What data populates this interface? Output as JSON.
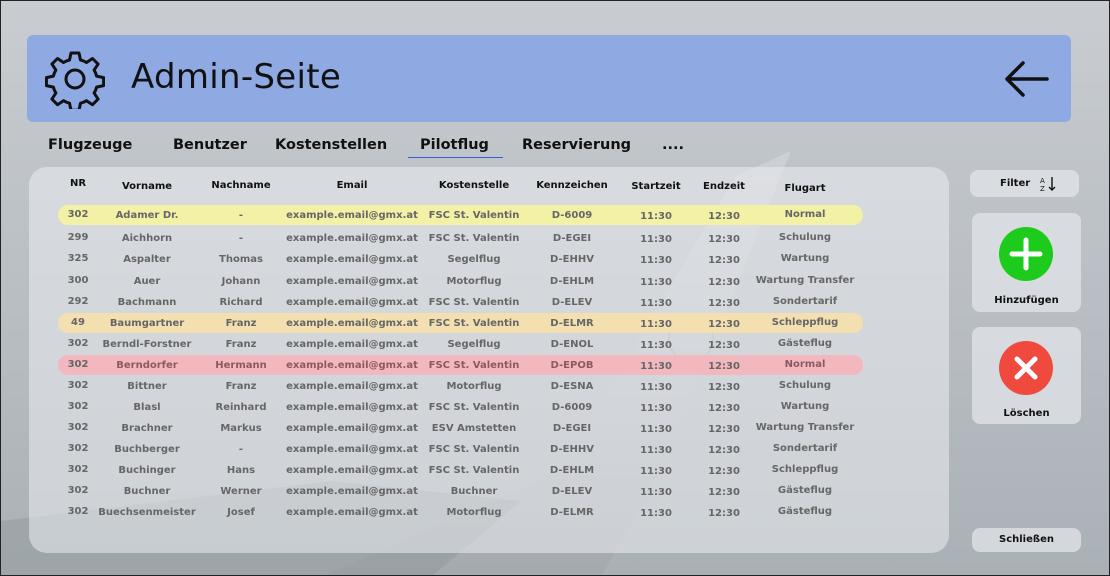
{
  "header": {
    "title": "Admin-Seite",
    "settings_icon": "gear-icon",
    "back_icon": "arrow-left-icon"
  },
  "tabs": [
    {
      "label": "Flugzeuge"
    },
    {
      "label": "Benutzer"
    },
    {
      "label": "Kostenstellen"
    },
    {
      "label": "Pilotflug",
      "active": true
    },
    {
      "label": "Reservierung"
    },
    {
      "label": "...."
    }
  ],
  "table": {
    "columns": [
      "NR",
      "Vorname",
      "Nachname",
      "Email",
      "Kostenstelle",
      "Kennzeichen",
      "Startzeit",
      "Endzeit",
      "Flugart"
    ],
    "rows": [
      {
        "nr": "302",
        "vorname": "Adamer Dr.",
        "nachname": "-",
        "email": "example.email@gmx.at",
        "kostenstelle": "FSC St. Valentin",
        "kennzeichen": "D-6009",
        "start": "11:30",
        "end": "12:30",
        "flugart": "Normal",
        "highlight": "#f3f1a6"
      },
      {
        "nr": "299",
        "vorname": "Aichhorn",
        "nachname": "-",
        "email": "example.email@gmx.at",
        "kostenstelle": "FSC St. Valentin",
        "kennzeichen": "D-EGEI",
        "start": "11:30",
        "end": "12:30",
        "flugart": "Schulung",
        "highlight": ""
      },
      {
        "nr": "325",
        "vorname": "Aspalter",
        "nachname": "Thomas",
        "email": "example.email@gmx.at",
        "kostenstelle": "Segelflug",
        "kennzeichen": "D-EHHV",
        "start": "11:30",
        "end": "12:30",
        "flugart": "Wartung",
        "highlight": ""
      },
      {
        "nr": "300",
        "vorname": "Auer",
        "nachname": "Johann",
        "email": "example.email@gmx.at",
        "kostenstelle": "Motorflug",
        "kennzeichen": "D-EHLM",
        "start": "11:30",
        "end": "12:30",
        "flugart": "Wartung Transfer",
        "highlight": ""
      },
      {
        "nr": "292",
        "vorname": "Bachmann",
        "nachname": "Richard",
        "email": "example.email@gmx.at",
        "kostenstelle": "FSC St. Valentin",
        "kennzeichen": "D-ELEV",
        "start": "11:30",
        "end": "12:30",
        "flugart": "Sondertarif",
        "highlight": ""
      },
      {
        "nr": "49",
        "vorname": "Baumgartner",
        "nachname": "Franz",
        "email": "example.email@gmx.at",
        "kostenstelle": "FSC St. Valentin",
        "kennzeichen": "D-ELMR",
        "start": "11:30",
        "end": "12:30",
        "flugart": "Schleppflug",
        "highlight": "#f4dfb0"
      },
      {
        "nr": "302",
        "vorname": "Berndl-Forstner",
        "nachname": "Franz",
        "email": "example.email@gmx.at",
        "kostenstelle": "Segelflug",
        "kennzeichen": "D-ENOL",
        "start": "11:30",
        "end": "12:30",
        "flugart": "Gästeflug",
        "highlight": ""
      },
      {
        "nr": "302",
        "vorname": "Berndorfer",
        "nachname": "Hermann",
        "email": "example.email@gmx.at",
        "kostenstelle": "FSC St. Valentin",
        "kennzeichen": "D-EPOB",
        "start": "11:30",
        "end": "12:30",
        "flugart": "Normal",
        "highlight": "#f2b8be"
      },
      {
        "nr": "302",
        "vorname": "Bittner",
        "nachname": "Franz",
        "email": "example.email@gmx.at",
        "kostenstelle": "Motorflug",
        "kennzeichen": "D-ESNA",
        "start": "11:30",
        "end": "12:30",
        "flugart": "Schulung",
        "highlight": ""
      },
      {
        "nr": "302",
        "vorname": "Blasl",
        "nachname": "Reinhard",
        "email": "example.email@gmx.at",
        "kostenstelle": "FSC St. Valentin",
        "kennzeichen": "D-6009",
        "start": "11:30",
        "end": "12:30",
        "flugart": "Wartung",
        "highlight": ""
      },
      {
        "nr": "302",
        "vorname": "Brachner",
        "nachname": "Markus",
        "email": "example.email@gmx.at",
        "kostenstelle": "ESV Amstetten",
        "kennzeichen": "D-EGEI",
        "start": "11:30",
        "end": "12:30",
        "flugart": "Wartung Transfer",
        "highlight": ""
      },
      {
        "nr": "302",
        "vorname": "Buchberger",
        "nachname": "-",
        "email": "example.email@gmx.at",
        "kostenstelle": "FSC St. Valentin",
        "kennzeichen": "D-EHHV",
        "start": "11:30",
        "end": "12:30",
        "flugart": "Sondertarif",
        "highlight": ""
      },
      {
        "nr": "302",
        "vorname": "Buchinger",
        "nachname": "Hans",
        "email": "example.email@gmx.at",
        "kostenstelle": "FSC St. Valentin",
        "kennzeichen": "D-EHLM",
        "start": "11:30",
        "end": "12:30",
        "flugart": "Schleppflug",
        "highlight": ""
      },
      {
        "nr": "302",
        "vorname": "Buchner",
        "nachname": "Werner",
        "email": "example.email@gmx.at",
        "kostenstelle": "Buchner",
        "kennzeichen": "D-ELEV",
        "start": "11:30",
        "end": "12:30",
        "flugart": "Gästeflug",
        "highlight": ""
      },
      {
        "nr": "302",
        "vorname": "Buechsenmeister",
        "nachname": "Josef",
        "email": "example.email@gmx.at",
        "kostenstelle": "Motorflug",
        "kennzeichen": "D-ELMR",
        "start": "11:30",
        "end": "12:30",
        "flugart": "Gästeflug",
        "highlight": ""
      }
    ]
  },
  "sidebar": {
    "filter_label": "Filter",
    "filter_icon": "sort-az-icon",
    "add_label": "Hinzufügen",
    "add_icon": "plus-icon",
    "delete_label": "Löschen",
    "delete_icon": "x-icon",
    "close_label": "Schließen"
  },
  "colors": {
    "header": "#8fa9e3",
    "add": "#1ccb1c",
    "delete": "#f04a3e",
    "active_tab_underline": "#3b5bdb"
  }
}
